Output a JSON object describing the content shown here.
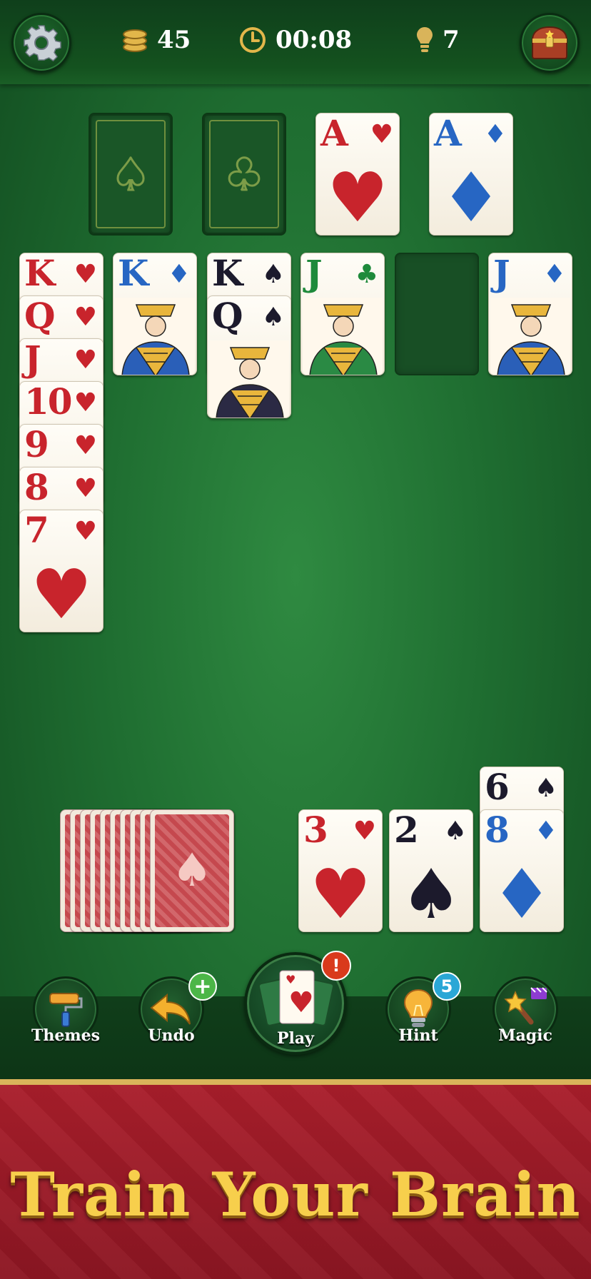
{
  "header": {
    "coins": "45",
    "timer": "00:08",
    "hints_count": "7"
  },
  "foundations": [
    {
      "type": "empty",
      "suit": "♠"
    },
    {
      "type": "empty",
      "suit": "♣"
    },
    {
      "type": "card",
      "rank": "A",
      "suit": "♥",
      "color": "red"
    },
    {
      "type": "card",
      "rank": "A",
      "suit": "♦",
      "color": "blu"
    }
  ],
  "tableau": [
    {
      "cards": [
        {
          "rank": "K",
          "suit": "♥",
          "color": "red"
        },
        {
          "rank": "Q",
          "suit": "♥",
          "color": "red"
        },
        {
          "rank": "J",
          "suit": "♥",
          "color": "red"
        },
        {
          "rank": "10",
          "suit": "♥",
          "color": "red"
        },
        {
          "rank": "9",
          "suit": "♥",
          "color": "red"
        },
        {
          "rank": "8",
          "suit": "♥",
          "color": "red"
        },
        {
          "rank": "7",
          "suit": "♥",
          "color": "red"
        }
      ]
    },
    {
      "cards": [
        {
          "rank": "K",
          "suit": "♦",
          "color": "blu",
          "face": "king"
        }
      ]
    },
    {
      "cards": [
        {
          "rank": "K",
          "suit": "♠",
          "color": "blk"
        },
        {
          "rank": "Q",
          "suit": "♠",
          "color": "blk",
          "face": "queen"
        }
      ]
    },
    {
      "cards": [
        {
          "rank": "J",
          "suit": "♣",
          "color": "grn",
          "face": "jack"
        }
      ]
    },
    {
      "cards": []
    },
    {
      "cards": [
        {
          "rank": "J",
          "suit": "♦",
          "color": "blu",
          "face": "jack"
        }
      ]
    }
  ],
  "stock_count": 10,
  "waste": [
    {
      "rank": "3",
      "suit": "♥",
      "color": "red"
    },
    {
      "rank": "2",
      "suit": "♠",
      "color": "blk"
    },
    {
      "rank": "6",
      "suit": "♠",
      "color": "blk"
    },
    {
      "rank": "8",
      "suit": "♦",
      "color": "blu"
    }
  ],
  "toolbar": {
    "themes_label": "Themes",
    "undo_label": "Undo",
    "play_label": "Play",
    "hint_label": "Hint",
    "hint_badge": "5",
    "magic_label": "Magic",
    "undo_badge": "+",
    "play_badge": "!"
  },
  "banner": {
    "title": "Train Your Brain"
  },
  "colors": {
    "felt": "#1f6e31",
    "banner_red": "#a91e2b",
    "gold": "#f7cf4c"
  }
}
